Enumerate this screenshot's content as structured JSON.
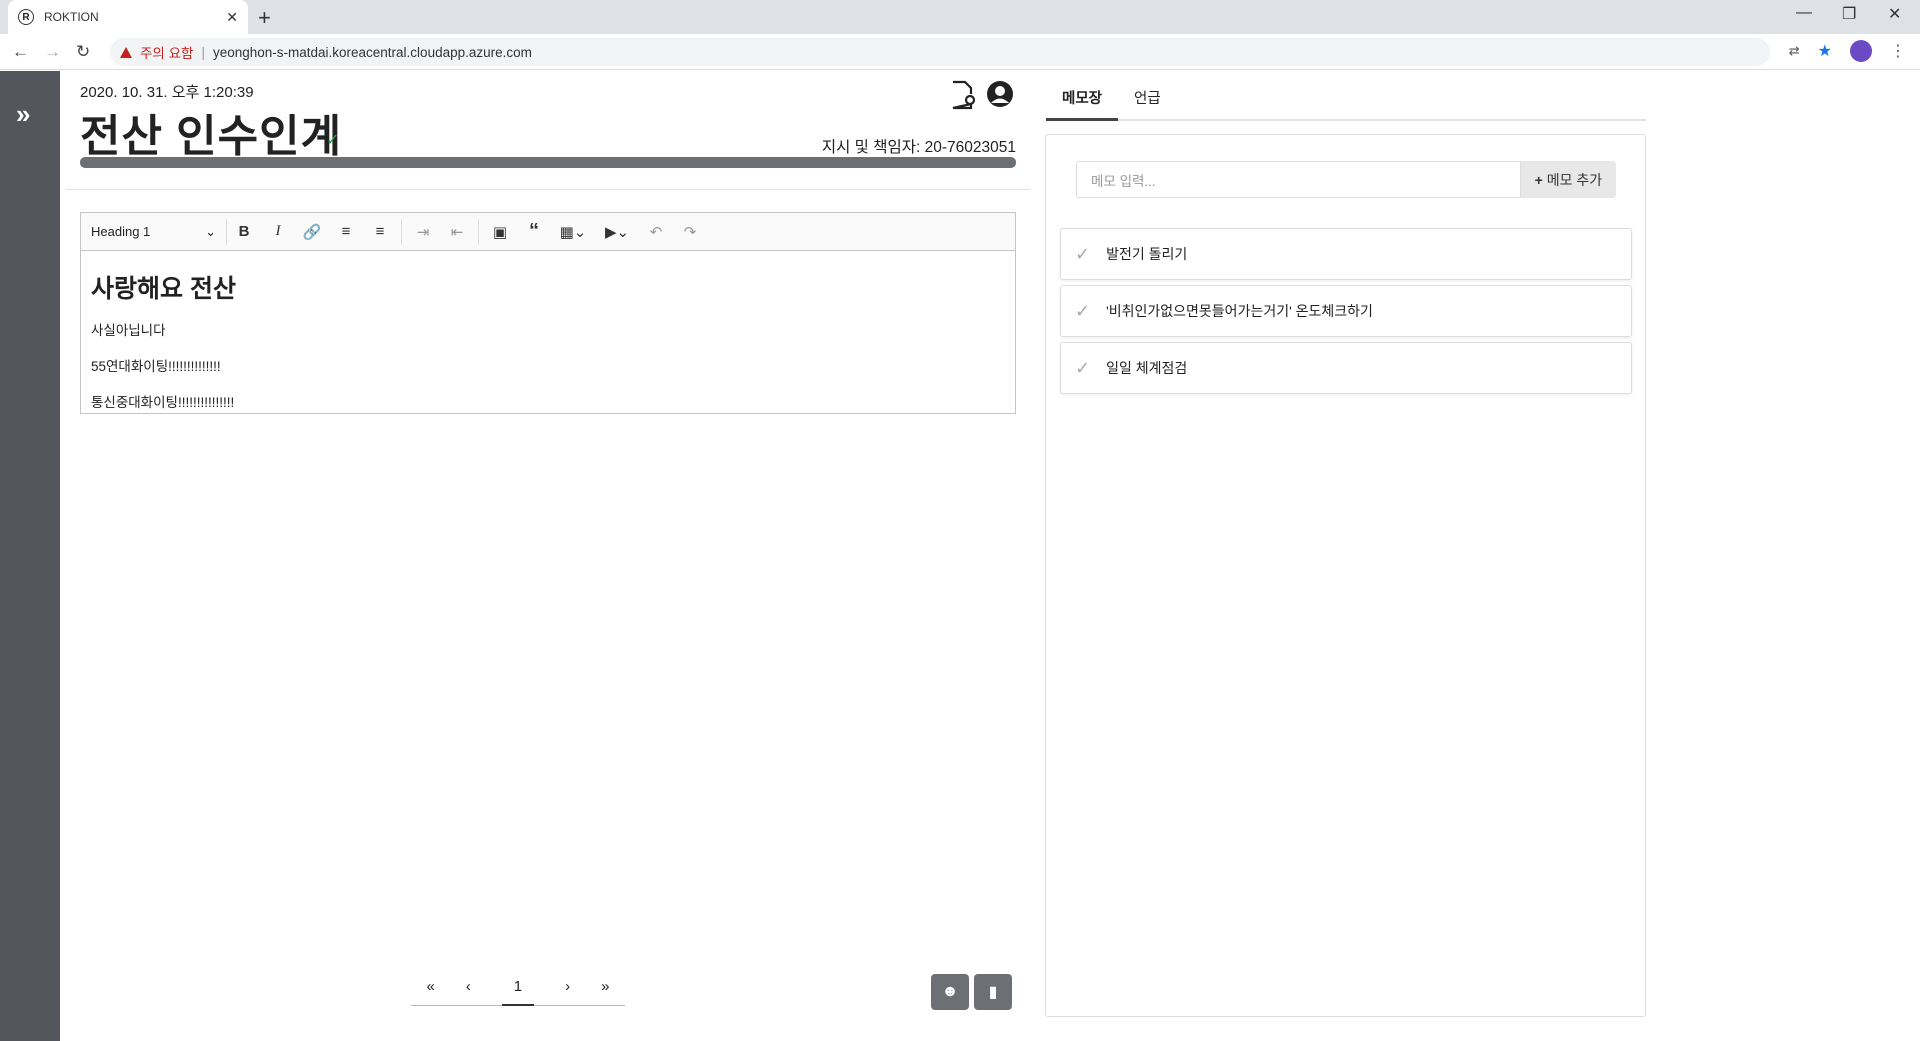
{
  "browser": {
    "tab_title": "ROKTION",
    "favicon": "R",
    "security_warning": "주의 요함",
    "url": "yeonghon-s-matdai.koreacentral.cloudapp.azure.com"
  },
  "document": {
    "date": "2020. 10. 31. 오후 1:20:39",
    "title": "전산 인수인계",
    "meta": "지시 및 책임자: 20-76023051"
  },
  "editor": {
    "heading_select": "Heading 1",
    "heading": "사랑해요 전산",
    "paragraphs": [
      "사실아닙니다",
      "55연대화이팅!!!!!!!!!!!!!!",
      "통신중대화이팅!!!!!!!!!!!!!!!"
    ]
  },
  "pager": {
    "first": "«",
    "prev": "‹",
    "current": "1",
    "next": "›",
    "last": "»"
  },
  "panel": {
    "tabs": [
      "메모장",
      "언급"
    ],
    "memo_placeholder": "메모 입력...",
    "memo_add_label": "메모 추가",
    "memos": [
      "발전기 돌리기",
      "'비취인가없으면못들어가는거기' 온도체크하기",
      "일일 체계점검"
    ]
  }
}
